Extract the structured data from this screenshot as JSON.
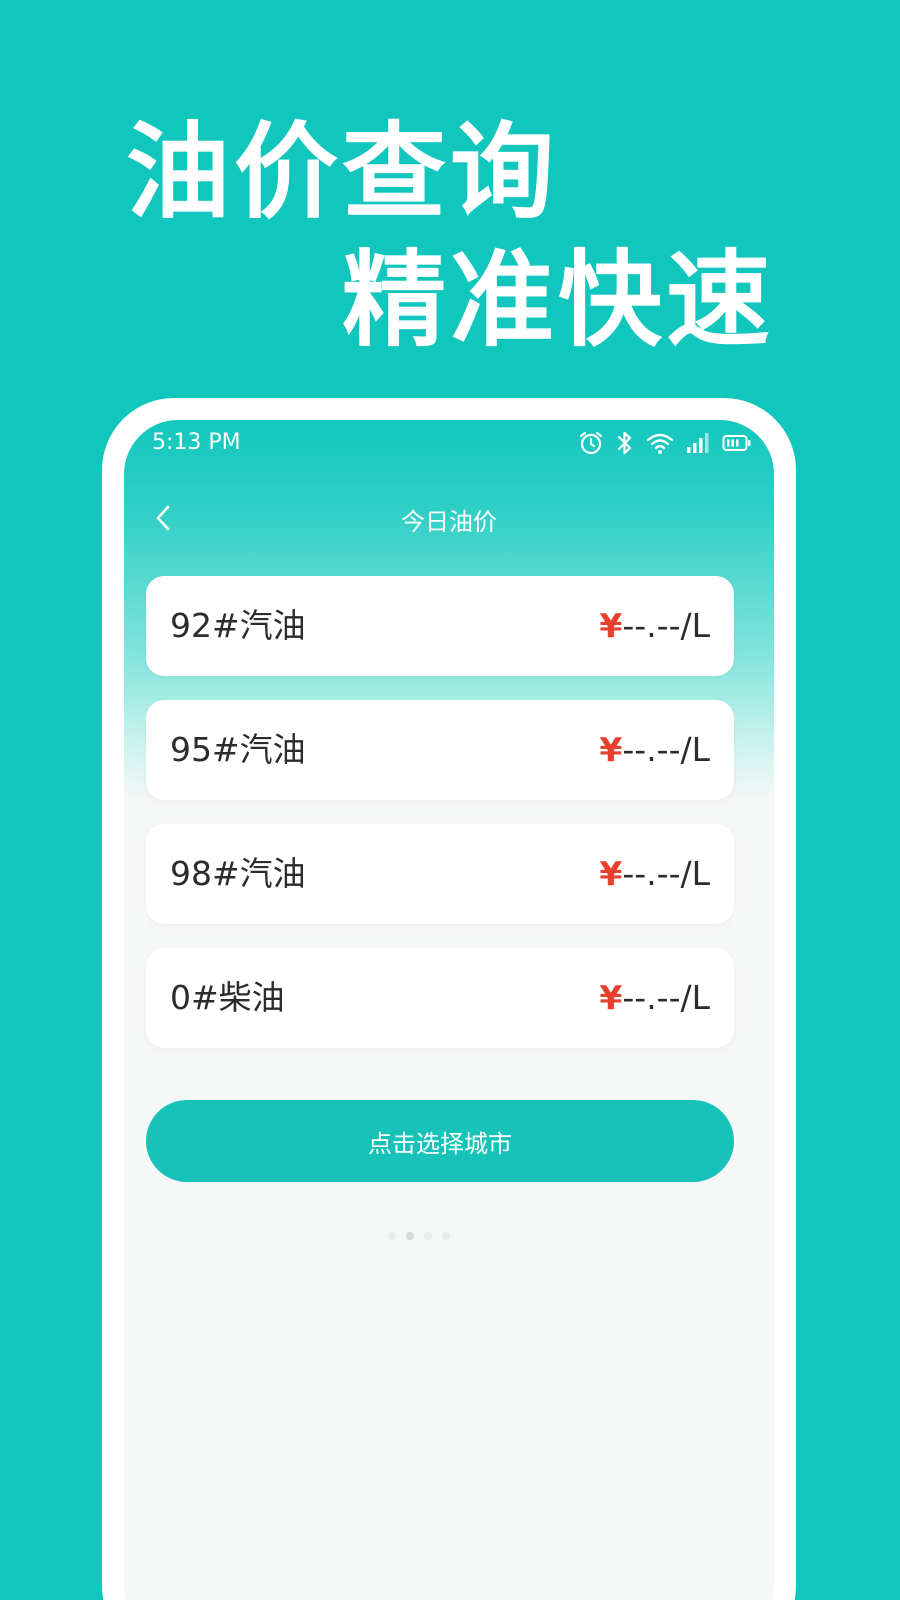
{
  "promo": {
    "line1": "油价查询",
    "line2": "精准快速"
  },
  "status_bar": {
    "time": "5:13 PM",
    "icons": [
      "alarm-icon",
      "bluetooth-icon",
      "wifi-icon",
      "signal-icon",
      "battery-icon"
    ]
  },
  "nav": {
    "title": "今日油价",
    "back_icon": "chevron-left-icon"
  },
  "prices": [
    {
      "name": "92#汽油",
      "currency": "¥",
      "value": "--.--/L"
    },
    {
      "name": "95#汽油",
      "currency": "¥",
      "value": "--.--/L"
    },
    {
      "name": "98#汽油",
      "currency": "¥",
      "value": "--.--/L"
    },
    {
      "name": "0#柴油",
      "currency": "¥",
      "value": "--.--/L"
    }
  ],
  "select_city": {
    "label": "点击选择城市"
  },
  "pager": {
    "count": 4,
    "active_index": 1
  },
  "colors": {
    "brand": "#10c6bd",
    "button": "#17c2b8",
    "currency": "#e8402f",
    "text": "#2c2c2c"
  }
}
